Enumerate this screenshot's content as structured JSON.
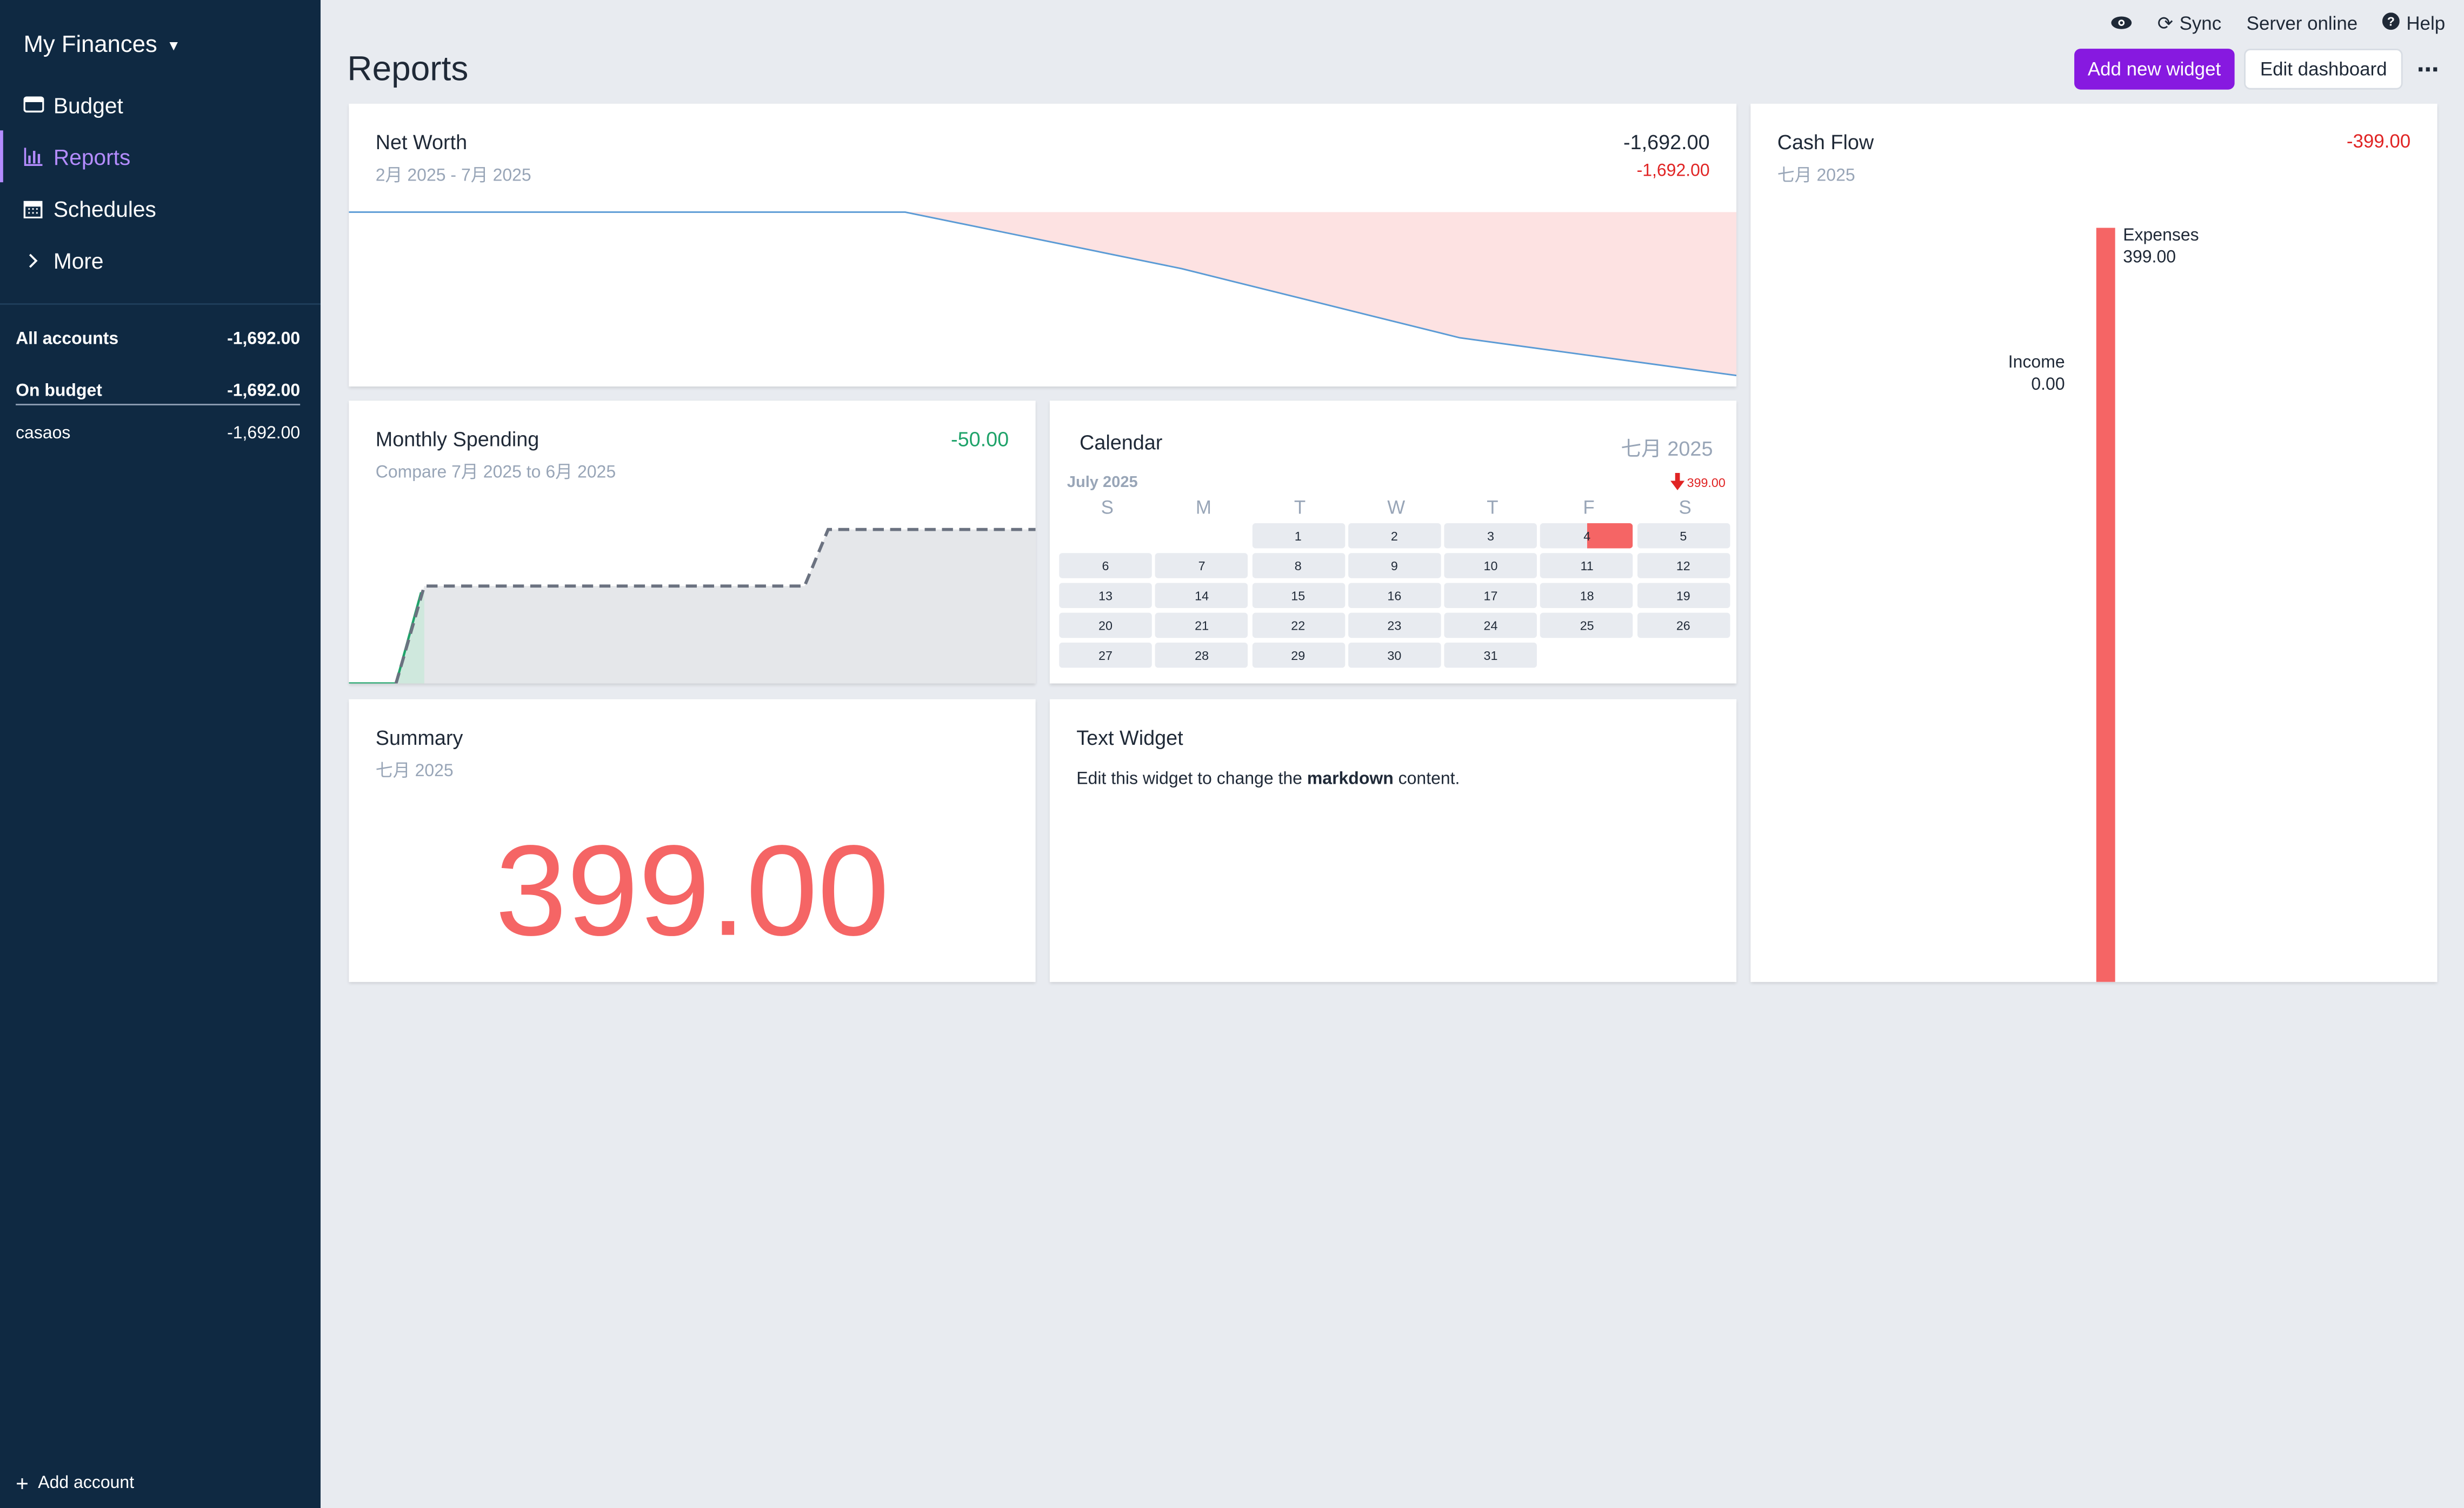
{
  "sidebar": {
    "budget_name": "My Finances",
    "nav": [
      {
        "label": "Budget",
        "icon": "wallet-icon"
      },
      {
        "label": "Reports",
        "icon": "bar-chart-icon",
        "active": true
      },
      {
        "label": "Schedules",
        "icon": "calendar-icon"
      },
      {
        "label": "More",
        "icon": "chevron-right-icon"
      }
    ],
    "accounts": [
      {
        "name": "All accounts",
        "balance": "-1,692.00"
      },
      {
        "name": "On budget",
        "balance": "-1,692.00"
      },
      {
        "name": "casaos",
        "balance": "-1,692.00"
      }
    ],
    "add_account": "Add account"
  },
  "topbar": {
    "sync": "Sync",
    "server_status": "Server online",
    "help": "Help"
  },
  "page": {
    "title": "Reports",
    "add_widget": "Add new widget",
    "edit_dashboard": "Edit dashboard",
    "more": "⋯"
  },
  "widgets": {
    "net_worth": {
      "title": "Net Worth",
      "subtitle": "2月 2025 - 7月 2025",
      "value": "-1,692.00",
      "change": "-1,692.00"
    },
    "cash_flow": {
      "title": "Cash Flow",
      "subtitle": "七月 2025",
      "value": "-399.00",
      "expenses_label": "Expenses",
      "expenses_value": "399.00",
      "income_label": "Income",
      "income_value": "0.00"
    },
    "monthly_spending": {
      "title": "Monthly Spending",
      "subtitle": "Compare 7月 2025 to 6月 2025",
      "value": "-50.00"
    },
    "calendar": {
      "title": "Calendar",
      "period": "七月 2025",
      "month_label": "July 2025",
      "total": "399.00",
      "weekdays": [
        "S",
        "M",
        "T",
        "W",
        "T",
        "F",
        "S"
      ]
    },
    "summary": {
      "title": "Summary",
      "subtitle": "七月 2025",
      "value": "399.00"
    },
    "text": {
      "title": "Text Widget",
      "before": "Edit this widget to change the ",
      "bold": "markdown",
      "after": " content."
    }
  },
  "colors": {
    "accent": "#8719e0",
    "negative": "#e02424",
    "positive": "#1fa36a",
    "expense": "#f56565",
    "sidebar": "#0f2942"
  }
}
